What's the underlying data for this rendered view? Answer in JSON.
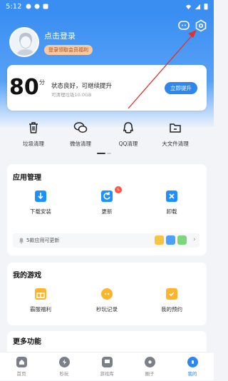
{
  "status_bar": {
    "time": "5:12"
  },
  "profile": {
    "login_label": "点击登录",
    "vip_badge": "登录领取会员福利"
  },
  "top_icons": {
    "message": "message-icon",
    "settings": "settings-icon"
  },
  "score_card": {
    "score": "80",
    "score_unit": "分",
    "status": "状态良好，可继续提升",
    "subtext": "可清理垃圾10.0GB",
    "button": "立即提升"
  },
  "clean_tools": [
    {
      "label": "垃圾清理",
      "icon": "trash-icon"
    },
    {
      "label": "微信清理",
      "icon": "wechat-icon"
    },
    {
      "label": "QQ清理",
      "icon": "qq-icon"
    },
    {
      "label": "大文件清理",
      "icon": "folder-icon"
    }
  ],
  "app_manage": {
    "title": "应用管理",
    "items": [
      {
        "label": "下载安装",
        "icon": "download-icon"
      },
      {
        "label": "更新",
        "icon": "update-icon",
        "badge": "5"
      },
      {
        "label": "卸载",
        "icon": "uninstall-icon"
      }
    ],
    "update_notice": "5款应用可更新"
  },
  "my_games": {
    "title": "我的游戏",
    "items": [
      {
        "label": "霸服福利",
        "icon": "gift-icon"
      },
      {
        "label": "秒玩记录",
        "icon": "gamepad-icon"
      },
      {
        "label": "我的预约",
        "icon": "calendar-icon"
      }
    ]
  },
  "more": {
    "title": "更多功能"
  },
  "tabs": [
    {
      "label": "首页",
      "icon": "home-icon"
    },
    {
      "label": "秒玩",
      "icon": "lightning-icon"
    },
    {
      "label": "游戏库",
      "icon": "library-icon"
    },
    {
      "label": "圈子",
      "icon": "circle-icon"
    },
    {
      "label": "我的",
      "icon": "profile-icon",
      "active": true
    }
  ],
  "colors": {
    "primary": "#2f86ef",
    "header": "#3a8ef2",
    "badge": "#ff5342"
  }
}
